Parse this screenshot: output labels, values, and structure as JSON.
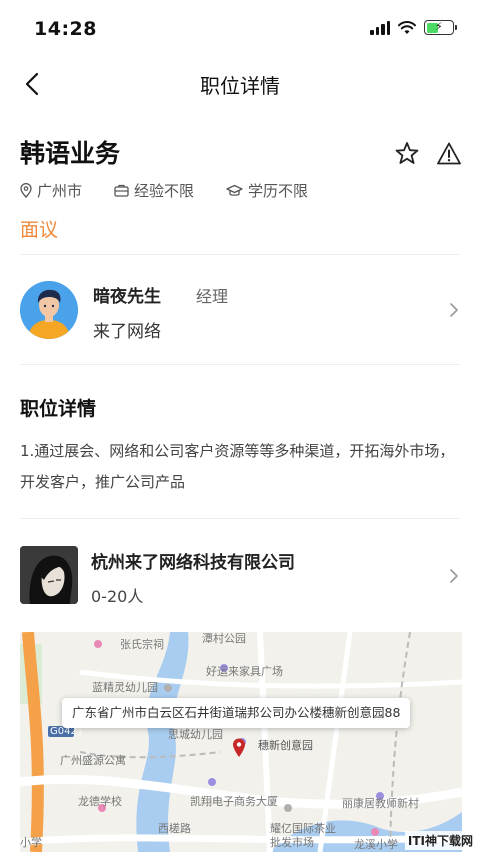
{
  "status_bar": {
    "time": "14:28"
  },
  "nav": {
    "title": "职位详情"
  },
  "job": {
    "title": "韩语业务",
    "tags": [
      {
        "icon": "location-pin-icon",
        "label": "广州市"
      },
      {
        "icon": "briefcase-icon",
        "label": "经验不限"
      },
      {
        "icon": "graduation-cap-icon",
        "label": "学历不限"
      }
    ],
    "salary": "面议",
    "salary_color": "#f08a3c"
  },
  "recruiter": {
    "name": "暗夜先生",
    "role": "经理",
    "company": "来了网络"
  },
  "details": {
    "heading": "职位详情",
    "description": "1.通过展会、网络和公司客户资源等等多种渠道，开拓海外市场，开发客户，推广公司产品"
  },
  "company": {
    "name": "杭州来了网络科技有限公司",
    "size": "0-20人"
  },
  "map": {
    "address": "广东省广州市白云区石井街道瑞邦公司办公楼穗新创意园88",
    "labels": [
      {
        "text": "张氏宗祠"
      },
      {
        "text": "潭村公园"
      },
      {
        "text": "好运来家具广场"
      },
      {
        "text": "蓝精灵幼儿园"
      },
      {
        "text": "G0421"
      },
      {
        "text": "思城幼儿园"
      },
      {
        "text": "穗新创意园"
      },
      {
        "text": "广州盛源公寓"
      },
      {
        "text": "龙德学校"
      },
      {
        "text": "凯翔电子商务大厦"
      },
      {
        "text": "丽康居教师新村"
      },
      {
        "text": "西槎路"
      },
      {
        "text": "耀亿国际茶业批发市场"
      },
      {
        "text": "龙溪小学"
      },
      {
        "text": "小学"
      }
    ]
  },
  "watermark": "ITI神下载网"
}
